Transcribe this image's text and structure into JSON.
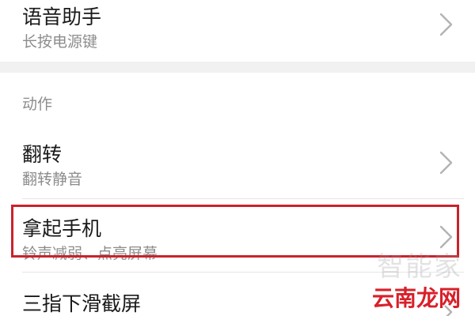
{
  "settings": {
    "voice_assistant": {
      "title": "语音助手",
      "subtitle": "长按电源键",
      "icon": "chevron-right-icon"
    },
    "section_label": "动作",
    "flip": {
      "title": "翻转",
      "subtitle": "翻转静音",
      "icon": "chevron-right-icon"
    },
    "pick_up": {
      "title": "拿起手机",
      "subtitle": "铃声减弱、点亮屏幕",
      "icon": "chevron-right-icon"
    },
    "three_finger": {
      "title": "三指下滑截屏",
      "icon": "chevron-right-icon"
    }
  },
  "annotation": {
    "highlight_color": "#c8232c"
  },
  "watermarks": {
    "faint": "智能家",
    "brand": "云南龙网"
  },
  "colors": {
    "title_text": "#1a1a1a",
    "subtitle_text": "#8c8c8c",
    "chevron": "#b3b3b3",
    "divider": "#e6e6e6",
    "section_gap": "#f1f1f1"
  }
}
